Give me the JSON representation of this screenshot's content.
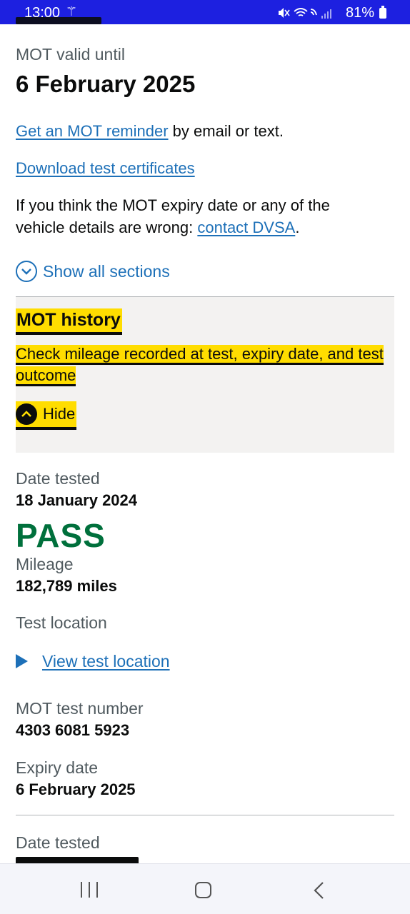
{
  "status_bar": {
    "time": "13:00",
    "battery": "81%",
    "icons": [
      "magic-wand-icon",
      "mute-icon",
      "wifi-icon",
      "wifi-call-icon",
      "signal-icon",
      "battery-icon"
    ]
  },
  "summary": {
    "mot_valid_label": "MOT valid until",
    "mot_valid_date": "6 February 2025",
    "reminder_link": "Get an MOT reminder",
    "reminder_suffix": " by email or text.",
    "download_link": "Download test certificates",
    "wrong_text": "If you think the MOT expiry date or any of the vehicle details are wrong: ",
    "contact_link": "contact DVSA",
    "wrong_suffix": "."
  },
  "show_all_sections": "Show all sections",
  "accordion": {
    "title": "MOT history",
    "summary": "Check mileage recorded at test, expiry date, and test outcome",
    "hide_label": "Hide"
  },
  "test": {
    "date_label": "Date tested",
    "date": "18 January 2024",
    "result": "PASS",
    "mileage_label": "Mileage",
    "mileage": "182,789 miles",
    "location_label": "Test location",
    "location_link": "View test location",
    "number_label": "MOT test number",
    "number": "4303 6081 5923",
    "expiry_label": "Expiry date",
    "expiry": "6 February 2025"
  },
  "next_test": {
    "date_label": "Date tested"
  },
  "colors": {
    "link": "#1d70b8",
    "pass": "#00703c",
    "focus": "#ffdd00",
    "status_bar": "#1d20e0"
  }
}
